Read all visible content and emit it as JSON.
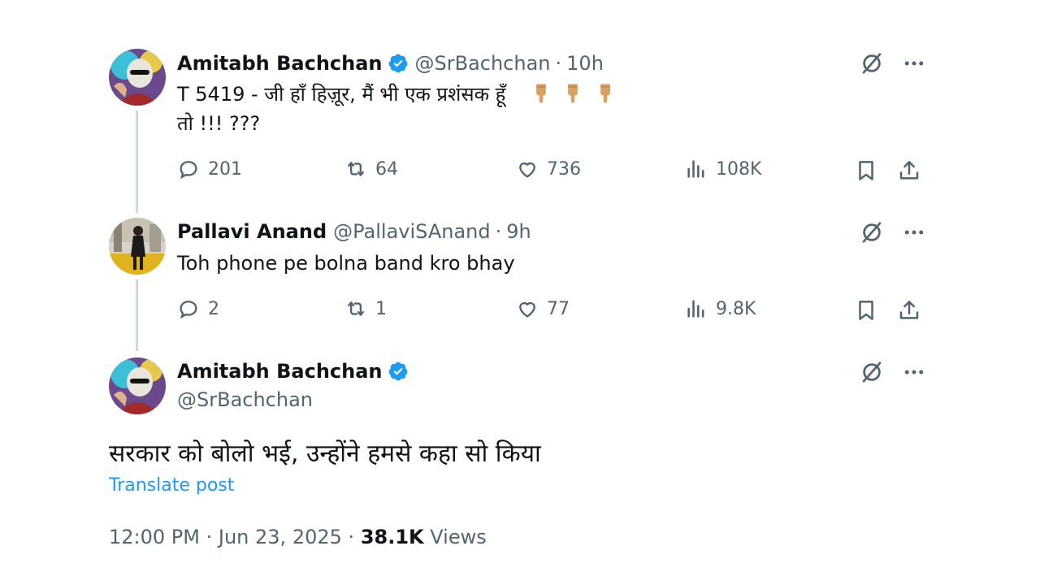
{
  "tweet1": {
    "avatar": "amitabh-avatar",
    "name": "Amitabh Bachchan",
    "handle": "@SrBachchan",
    "time": "10h",
    "text_line1": "T 5419 - जी हाँ हिज़ूर, मैं भी एक प्रशंसक हूँ",
    "text_emoji": [
      "pointing-down-emoji",
      "pointing-down-emoji",
      "pointing-down-emoji"
    ],
    "text_line2": "तो  !!! ???",
    "replies": "201",
    "reposts": "64",
    "likes": "736",
    "views": "108K"
  },
  "tweet2": {
    "avatar": "pallavi-avatar",
    "name": "Pallavi Anand",
    "handle": "@PallaviSAnand",
    "time": "9h",
    "text": "Toh phone pe bolna band kro bhay",
    "replies": "2",
    "reposts": "1",
    "likes": "77",
    "views": "9.8K"
  },
  "tweet3": {
    "avatar": "amitabh-avatar",
    "name": "Amitabh Bachchan",
    "handle": "@SrBachchan",
    "text": "सरकार को बोलो भई, उन्होंने हमसे कहा सो किया",
    "translate": "Translate post",
    "time": "12:00 PM",
    "date": "Jun 23, 2025",
    "views_count": "38.1K",
    "views_label": "Views"
  },
  "colors": {
    "verified": "#1d9bf0",
    "link": "#1d9bf0",
    "secondary_text": "#536471",
    "thread_line": "#cfd9de"
  }
}
